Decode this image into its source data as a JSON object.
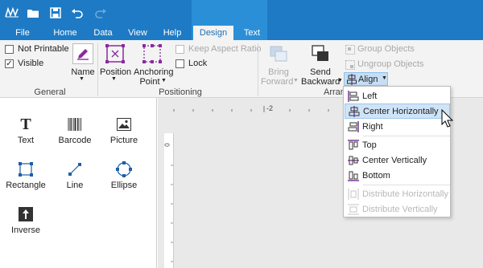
{
  "colors": {
    "accent": "#1e7ac4",
    "context_tab": "#2b8fd8",
    "highlight": "#cfe4f7"
  },
  "quick_access": [
    "app-logo-icon",
    "folder-icon",
    "save-icon",
    "undo-icon",
    "redo-icon"
  ],
  "tabs": [
    {
      "label": "File"
    },
    {
      "label": "Home"
    },
    {
      "label": "Data"
    },
    {
      "label": "View"
    },
    {
      "label": "Help"
    },
    {
      "label": "Design"
    },
    {
      "label": "Text"
    }
  ],
  "ribbon": {
    "general": {
      "not_printable": "Not Printable",
      "visible": "Visible",
      "name": "Name",
      "label": "General"
    },
    "positioning": {
      "position": "Position",
      "anchoring_line1": "Anchoring",
      "anchoring_line2": "Point",
      "keep_aspect": "Keep Aspect Ratio",
      "lock": "Lock",
      "label": "Positioning"
    },
    "arrange": {
      "bring_line1": "Bring",
      "bring_line2": "Forward",
      "send_line1": "Send",
      "send_line2": "Backward",
      "group": "Group Objects",
      "ungroup": "Ungroup Objects",
      "align": "Align",
      "label": "Arran"
    }
  },
  "palette": [
    {
      "label": "Text",
      "icon": "text-icon"
    },
    {
      "label": "Barcode",
      "icon": "barcode-icon"
    },
    {
      "label": "Picture",
      "icon": "picture-icon"
    },
    {
      "label": "Rectangle",
      "icon": "rectangle-icon"
    },
    {
      "label": "Line",
      "icon": "line-icon"
    },
    {
      "label": "Ellipse",
      "icon": "ellipse-icon"
    },
    {
      "label": "Inverse",
      "icon": "inverse-icon"
    }
  ],
  "ruler": {
    "top_mark": "-2",
    "left_mark": "0"
  },
  "align_menu": {
    "items": [
      {
        "label": "Left",
        "icon": "align-left-icon",
        "enabled": true
      },
      {
        "label": "Center Horizontally",
        "icon": "align-center-horizontal-icon",
        "enabled": true,
        "highlighted": true
      },
      {
        "label": "Right",
        "icon": "align-right-icon",
        "enabled": true
      },
      {
        "label": "Top",
        "icon": "align-top-icon",
        "enabled": true
      },
      {
        "label": "Center Vertically",
        "icon": "align-center-vertical-icon",
        "enabled": true
      },
      {
        "label": "Bottom",
        "icon": "align-bottom-icon",
        "enabled": true
      },
      {
        "label": "Distribute Horizontally",
        "icon": "distribute-horizontal-icon",
        "enabled": false
      },
      {
        "label": "Distribute Vertically",
        "icon": "distribute-vertical-icon",
        "enabled": false
      }
    ]
  }
}
